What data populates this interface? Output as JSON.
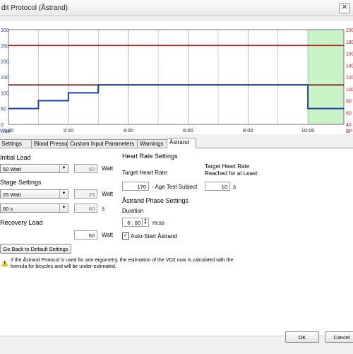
{
  "window": {
    "title": "dit Protocol (Åstrand)",
    "close_glyph": "✕"
  },
  "chart_data": {
    "type": "line",
    "x": [
      "0:00",
      "2:00",
      "4:00",
      "6:00",
      "8:00",
      "10:00"
    ],
    "xlim_minutes": [
      0,
      11.2
    ],
    "left_axis": {
      "unit_label": "Watt",
      "ticks": [
        "0",
        "50",
        "100",
        "150",
        "200",
        "250",
        "300"
      ],
      "ylim": [
        0,
        300
      ]
    },
    "right_axis": {
      "unit_label": "BP",
      "ticks": [
        "40",
        "60",
        "80",
        "100",
        "120",
        "140",
        "160",
        "180",
        "200"
      ],
      "ylim": [
        40,
        200
      ]
    },
    "grid": true,
    "series": [
      {
        "type": "step",
        "color": "#1f3fb0",
        "points_minutes_watt": [
          [
            0,
            50
          ],
          [
            1,
            50
          ],
          [
            1,
            75
          ],
          [
            2,
            75
          ],
          [
            2,
            100
          ],
          [
            3,
            100
          ],
          [
            3,
            125
          ],
          [
            10,
            125
          ],
          [
            10,
            50
          ],
          [
            11.2,
            50
          ]
        ]
      }
    ],
    "reference_lines": [
      {
        "axis": "left",
        "value": 250,
        "color": "#c0201c"
      },
      {
        "axis": "left",
        "value": 125,
        "color": "#7a1515"
      }
    ],
    "shaded_region": {
      "from_minute": 10,
      "to_minute": 11.2,
      "color": "#c8f4c8"
    }
  },
  "tabs": [
    {
      "label": "Settings",
      "active": false
    },
    {
      "label": "Blood Pressure",
      "active": false
    },
    {
      "label": "Custom Input Parameters",
      "active": false
    },
    {
      "label": "Warnings",
      "active": false
    },
    {
      "label": "Åstrand",
      "active": true
    }
  ],
  "initial_load": {
    "heading": "Initial Load",
    "select_value": "50 Watt",
    "value": "50",
    "unit": "Watt"
  },
  "stage_settings": {
    "heading": "Stage Settings",
    "load_select": "25 Watt",
    "load_value": "25",
    "load_unit": "Watt",
    "duration_select": "60 s",
    "duration_value": "60",
    "duration_unit": "s"
  },
  "recovery_load": {
    "heading": "Recovery Load",
    "value": "50",
    "unit": "Watt"
  },
  "default_button": "Go Back to Default Settings",
  "heart_rate": {
    "heading": "Heart Rate Settings",
    "target_label": "Target Heart Rate:",
    "target_value": "170",
    "target_suffix": "- Age Test Subject",
    "reached_label_1": "Target Heart Rate",
    "reached_label_2": "Reached for at Least:",
    "reached_value": "10",
    "reached_unit": "s"
  },
  "astrand_phase": {
    "heading": "Åstrand Phase Settings",
    "duration_label": "Duration",
    "duration_value": "6 : 00",
    "duration_unit": "m:ss",
    "autostart_label": "Auto-Start Åstrand",
    "autostart_checked": true
  },
  "warning": {
    "line1": "If the Åstrand Protocol is used for arm-ergometry, the estimation of the VO2 max is calculated with the",
    "line2": "formula for bicycles and will be under-estimated."
  },
  "footer": {
    "ok": "OK",
    "cancel": "Cancel"
  }
}
